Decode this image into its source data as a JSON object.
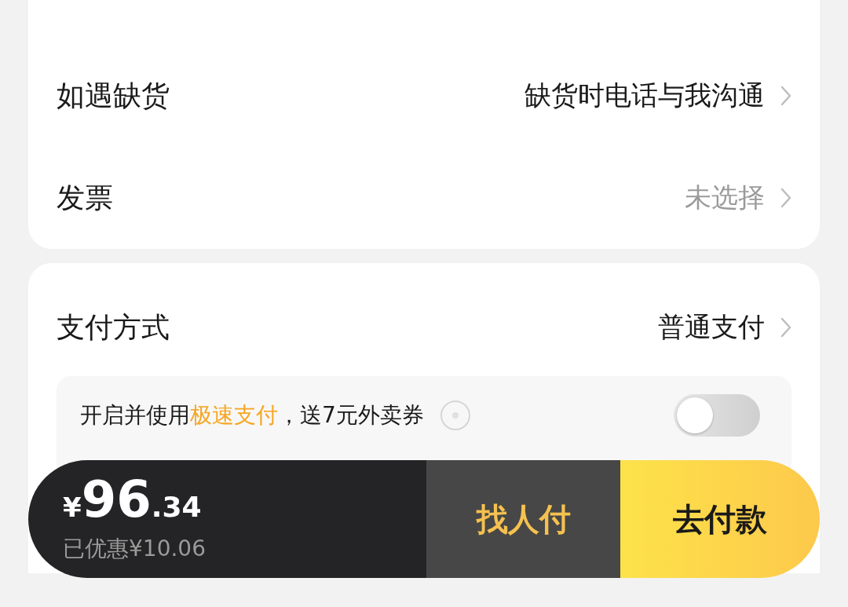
{
  "order_options": {
    "rows": [
      {
        "label": "如遇缺货",
        "value": "缺货时电话与我沟通",
        "muted": false
      },
      {
        "label": "发票",
        "value": "未选择",
        "muted": true
      }
    ]
  },
  "payment": {
    "label": "支付方式",
    "value": "普通支付",
    "promo": {
      "segments": [
        {
          "kind": "plain",
          "text": "开启并使用"
        },
        {
          "kind": "highlight",
          "text": "极速支付"
        },
        {
          "kind": "plain",
          "text": "，送7元外卖券"
        }
      ],
      "on": false
    }
  },
  "checkout_bar": {
    "price": {
      "currency": "¥",
      "integer": "96",
      "decimal": ".34"
    },
    "discount": "已优惠¥10.06",
    "secondary_button": "找人付",
    "primary_button": "去付款"
  }
}
